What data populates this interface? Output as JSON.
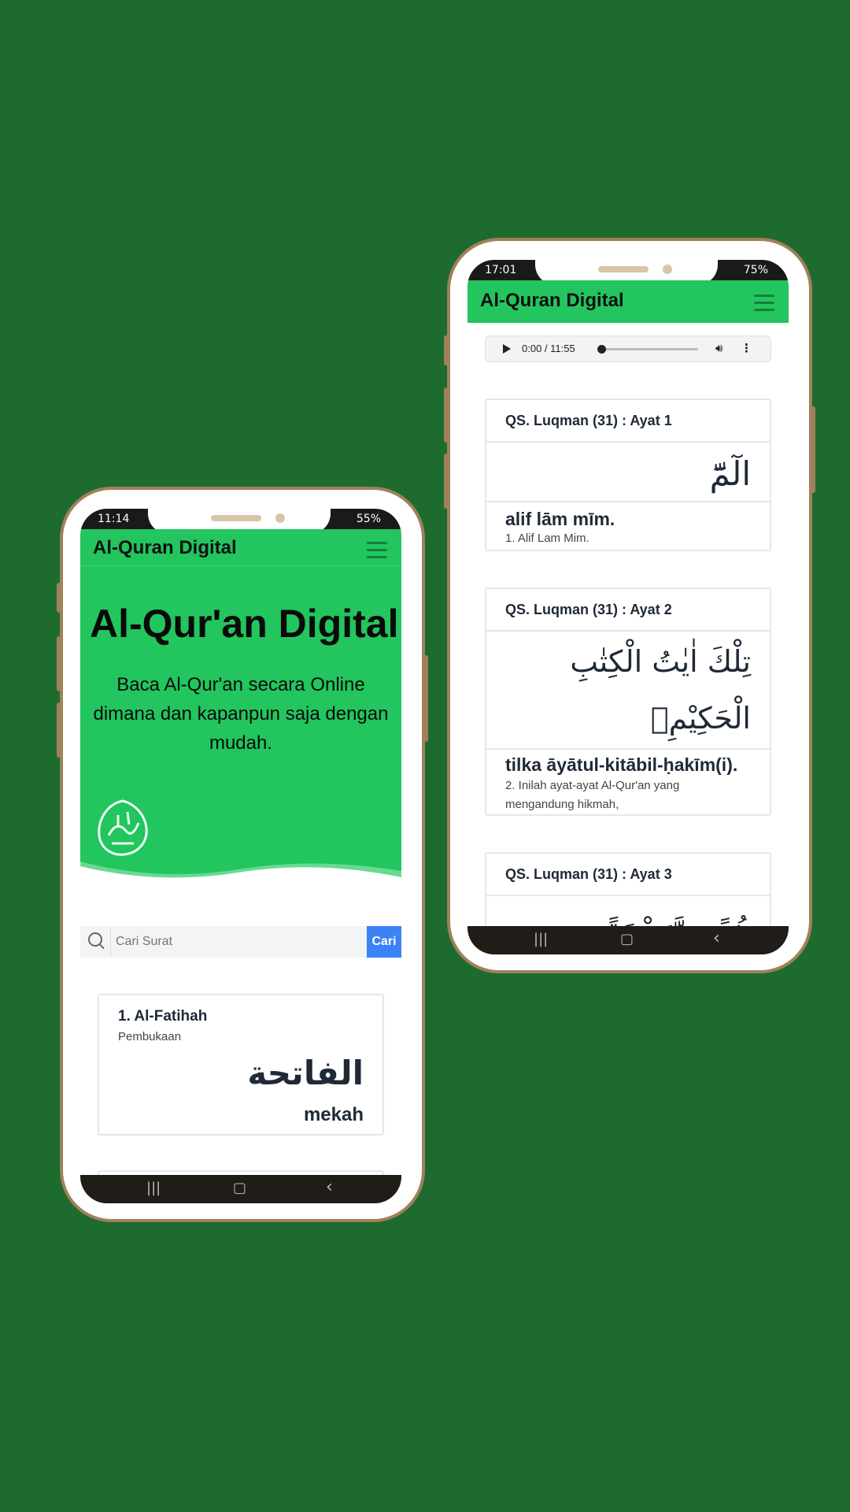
{
  "colors": {
    "background": "#1e6b30",
    "phone_frame": "#a08159",
    "primary_green": "#22c55e",
    "button_blue": "#3b82f6"
  },
  "left_phone": {
    "status": {
      "time": "11:14",
      "battery": "55%"
    },
    "navbar": {
      "brand": "Al-Quran Digital",
      "menu_icon": "hamburger-icon"
    },
    "hero": {
      "title": "Al-Qur'an Digital",
      "subtitle": "Baca Al-Qur'an secara Online dimana dan kapanpun saja dengan mudah.",
      "logo_icon": "quran-calligraphy-logo"
    },
    "search": {
      "placeholder": "Cari Surat",
      "button_label": "Cari",
      "icon": "search-icon"
    },
    "surah_list": [
      {
        "number_name": "1. Al-Fatihah",
        "meaning": "Pembukaan",
        "arabic": "الفاتحة",
        "place": "mekah"
      }
    ],
    "system_nav": {
      "recents": "|||",
      "home": "▢",
      "back": "‹"
    }
  },
  "right_phone": {
    "status": {
      "time": "17:01",
      "battery": "75%"
    },
    "navbar": {
      "brand": "Al-Quran Digital",
      "menu_icon": "hamburger-icon"
    },
    "audio": {
      "time": "0:00 / 11:55",
      "progress": 0
    },
    "ayahs": [
      {
        "header": "QS. Luqman (31) : Ayat 1",
        "arabic": "الٓمّٓ",
        "latin": "alif lām mīm.",
        "translation": "1. Alif Lam Mim."
      },
      {
        "header": "QS. Luqman (31) : Ayat 2",
        "arabic": "تِلْكَ اٰيٰتُ الْكِتٰبِ الْحَكِيْمِۙ",
        "latin": "tilka āyātul-kitābil-ḥakīm(i).",
        "translation": "2. Inilah ayat-ayat Al-Qur'an yang mengandung hikmah,"
      },
      {
        "header": "QS. Luqman (31) : Ayat 3",
        "arabic": "هُدًى وَّرَحْمَةً"
      }
    ],
    "system_nav": {
      "recents": "|||",
      "home": "▢",
      "back": "‹"
    }
  }
}
